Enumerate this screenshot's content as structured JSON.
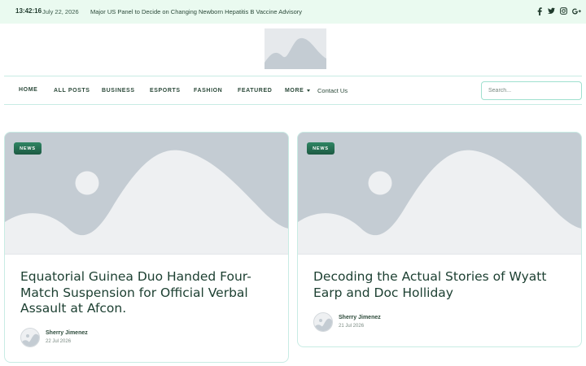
{
  "topbar": {
    "time": "13:42:16",
    "date": "July 22, 2026",
    "headline": "Major US Panel to Decide on Changing Newborn Hepatitis B Vaccine Advisory",
    "social": [
      {
        "icon": "facebook-icon",
        "glyph": "f"
      },
      {
        "icon": "twitter-icon",
        "glyph": "t"
      },
      {
        "icon": "instagram-icon",
        "glyph": "◎"
      },
      {
        "icon": "google-plus-icon",
        "glyph": "g+"
      }
    ]
  },
  "nav": {
    "items": [
      "HOME",
      "ALL POSTS",
      "BUSINESS",
      "ESPORTS",
      "FASHION",
      "FEATURED",
      "MORE"
    ],
    "contact": "Contact Us",
    "search_placeholder": "Search..."
  },
  "posts": [
    {
      "badge": "NEWS",
      "title": "Equatorial Guinea Duo Handed Four-Match Suspension for Official Verbal Assault at Afcon.",
      "author": "Sherry Jimenez",
      "date": "22 Jul 2026"
    },
    {
      "badge": "NEWS",
      "title": "Decoding the Actual Stories of Wyatt Earp and Doc Holliday",
      "author": "Sherry Jimenez",
      "date": "21 Jul 2026"
    }
  ],
  "colors": {
    "accent": "#2f8563",
    "topbar_bg": "#eafaf0",
    "border": "#c8ece4",
    "placeholder": "#c4ccd3"
  }
}
